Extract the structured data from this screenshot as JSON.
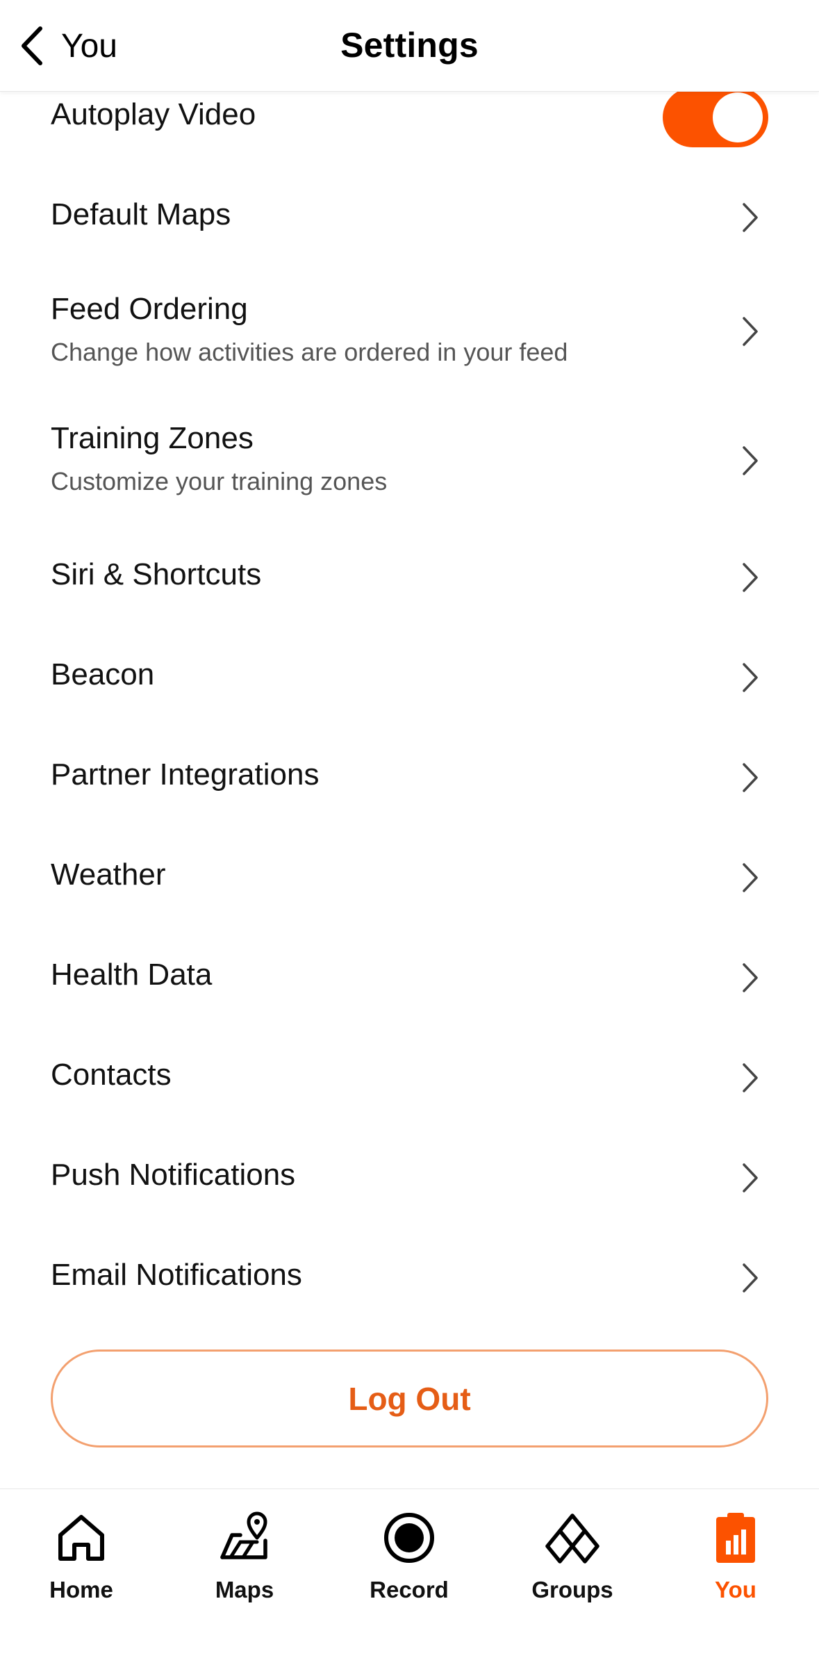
{
  "header": {
    "back_label": "You",
    "title": "Settings"
  },
  "settings": {
    "autoplay": {
      "label": "Autoplay Video",
      "enabled": true
    },
    "items": [
      {
        "label": "Default Maps",
        "sub": ""
      },
      {
        "label": "Feed Ordering",
        "sub": "Change how activities are ordered in your feed"
      },
      {
        "label": "Training Zones",
        "sub": "Customize your training zones"
      },
      {
        "label": "Siri & Shortcuts",
        "sub": ""
      },
      {
        "label": "Beacon",
        "sub": ""
      },
      {
        "label": "Partner Integrations",
        "sub": ""
      },
      {
        "label": "Weather",
        "sub": ""
      },
      {
        "label": "Health Data",
        "sub": ""
      },
      {
        "label": "Contacts",
        "sub": ""
      },
      {
        "label": "Push Notifications",
        "sub": ""
      },
      {
        "label": "Email Notifications",
        "sub": ""
      }
    ]
  },
  "logout_label": "Log Out",
  "tabbar": {
    "items": [
      {
        "label": "Home",
        "icon": "home-icon"
      },
      {
        "label": "Maps",
        "icon": "maps-icon"
      },
      {
        "label": "Record",
        "icon": "record-icon"
      },
      {
        "label": "Groups",
        "icon": "groups-icon"
      },
      {
        "label": "You",
        "icon": "you-icon",
        "active": true
      }
    ]
  },
  "colors": {
    "accent": "#fc5200",
    "logout_border": "#f3a06f"
  }
}
